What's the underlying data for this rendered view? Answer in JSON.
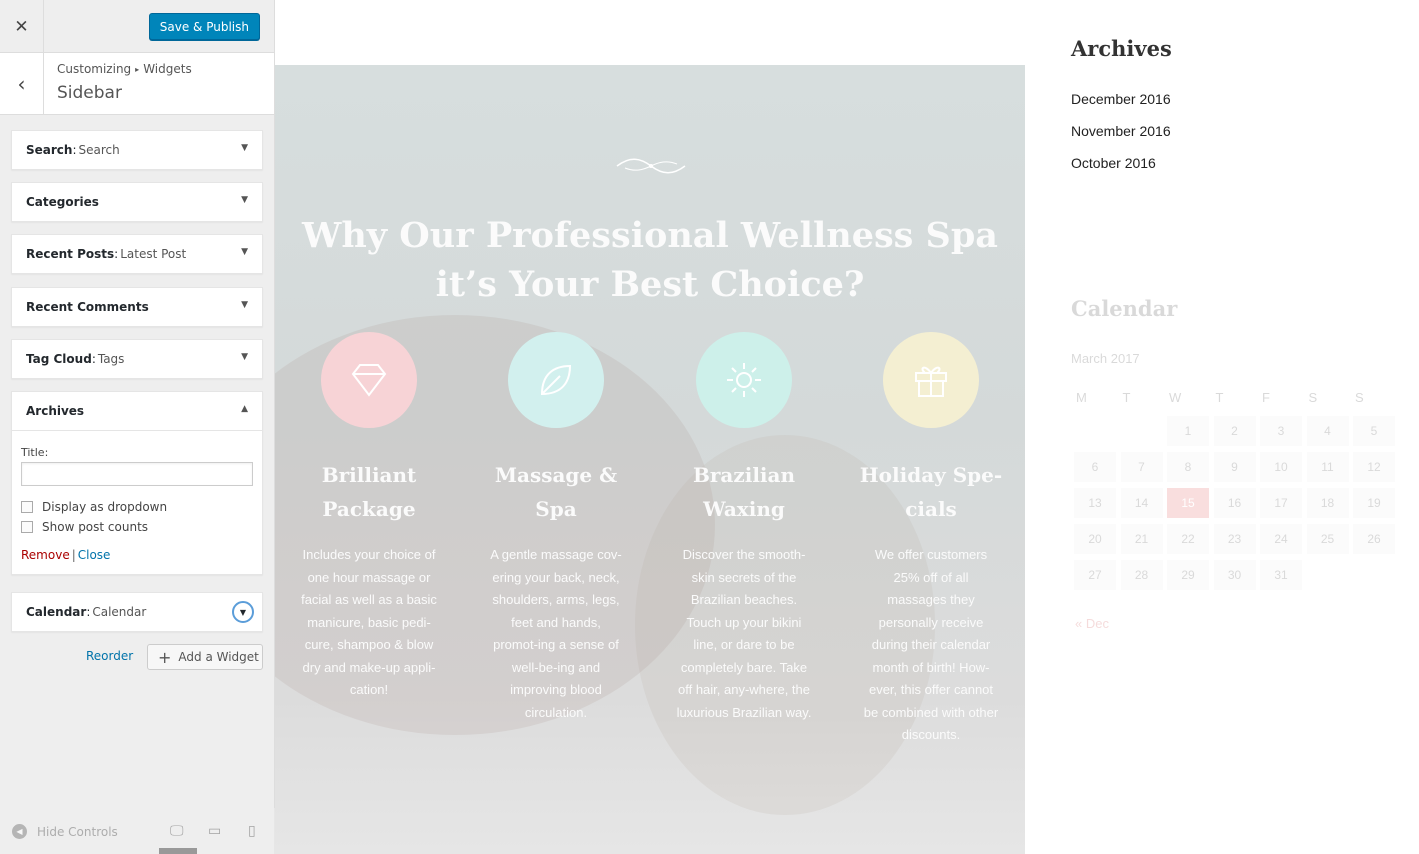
{
  "customizer": {
    "close_icon": "close-icon",
    "publish_label": "Save & Publish",
    "breadcrumb": {
      "parent": "Customizing",
      "current": "Widgets"
    },
    "section_title": "Sidebar",
    "widgets": [
      {
        "name": "Search",
        "title": "Search"
      },
      {
        "name": "Categories",
        "title": ""
      },
      {
        "name": "Recent Posts",
        "title": "Latest Post"
      },
      {
        "name": "Recent Comments",
        "title": ""
      },
      {
        "name": "Tag Cloud",
        "title": "Tags"
      },
      {
        "name": "Archives",
        "title": ""
      },
      {
        "name": "Calendar",
        "title": "Calendar"
      }
    ],
    "archives_form": {
      "title_label": "Title:",
      "title_value": "",
      "opt_dropdown": "Display as dropdown",
      "opt_counts": "Show post counts",
      "remove_label": "Remove",
      "separator": "|",
      "close_label": "Close"
    },
    "reorder_label": "Reorder",
    "add_widget_label": "Add a Widget",
    "hide_controls_label": "Hide Controls"
  },
  "preview": {
    "hero_title": "Why Our Professional Wellness Spa it’s Your Best Choice?",
    "features": [
      {
        "title": "Brilliant Package",
        "icon": "diamond-icon",
        "color": "#f7d3d6",
        "text": "Includes your choice of one hour massage or facial as well as a basic manicure, basic pedi-cure, shampoo & blow dry and make-up appli-cation!"
      },
      {
        "title": "Massage & Spa",
        "icon": "leaf-icon",
        "color": "#d2f0ee",
        "text": "A gentle massage cov-ering your back, neck, shoulders, arms, legs, feet and hands, promot-ing a sense of well-be-ing and improving blood circulation."
      },
      {
        "title": "Brazilian Waxing",
        "icon": "sun-icon",
        "color": "#cdf0ea",
        "text": "Discover the smooth-skin secrets of the Brazilian beaches. Touch up your bikini line, or dare to be completely bare. Take off hair, any-where, the luxurious Brazilian way."
      },
      {
        "title": "Holiday Spe-cials",
        "icon": "gift-icon",
        "color": "#f4efd2",
        "text": "We offer customers 25% off of all massages they personally receive during their calendar month of birth! How-ever, this offer cannot be combined with other discounts."
      }
    ],
    "archives": {
      "title": "Archives",
      "links": [
        "December 2016",
        "November 2016",
        "October 2016"
      ]
    },
    "calendar": {
      "title": "Calendar",
      "caption": "March 2017",
      "weekdays": [
        "M",
        "T",
        "W",
        "T",
        "F",
        "S",
        "S"
      ],
      "weeks": [
        [
          "",
          "",
          "1",
          "2",
          "3",
          "4",
          "5"
        ],
        [
          "6",
          "7",
          "8",
          "9",
          "10",
          "11",
          "12"
        ],
        [
          "13",
          "14",
          "15",
          "16",
          "17",
          "18",
          "19"
        ],
        [
          "20",
          "21",
          "22",
          "23",
          "24",
          "25",
          "26"
        ],
        [
          "27",
          "28",
          "29",
          "30",
          "31",
          "",
          ""
        ]
      ],
      "today": "15",
      "prev_label": "« Dec"
    },
    "colors": {
      "accent": "#0085ba",
      "today": "#e25050"
    }
  }
}
